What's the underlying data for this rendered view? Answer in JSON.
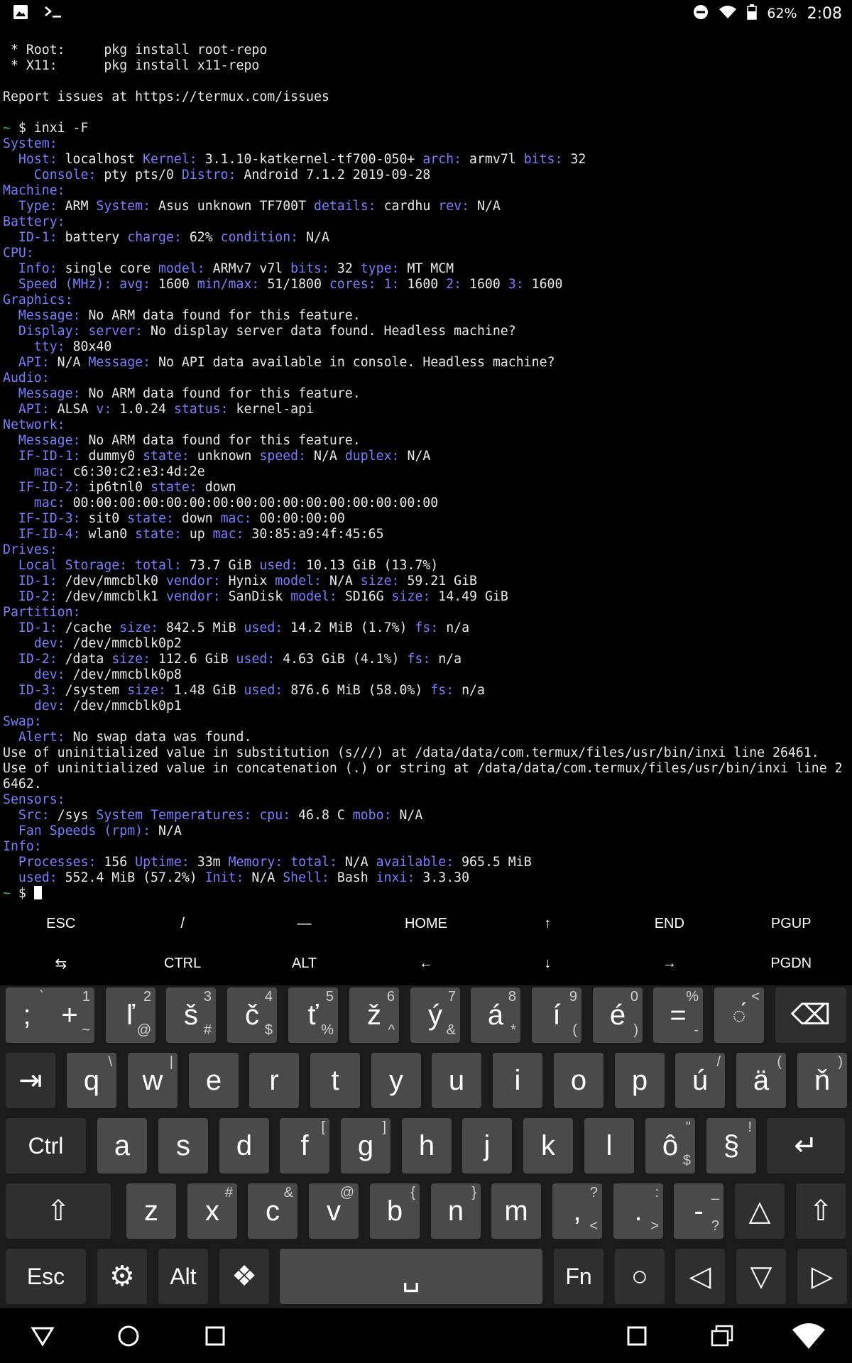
{
  "status_bar": {
    "battery_pct": "62%",
    "time": "2:08",
    "icons": [
      "image-icon",
      "terminal-icon",
      "dnd-icon",
      "wifi-icon",
      "battery-icon"
    ]
  },
  "terminal": {
    "lines": [
      [
        [
          "",
          " * Root:     pkg install root-repo"
        ]
      ],
      [
        [
          "",
          " * X11:      pkg install x11-repo"
        ]
      ],
      [
        [
          "",
          ""
        ]
      ],
      [
        [
          "",
          "Report issues at https://termux.com/issues"
        ]
      ],
      [
        [
          "",
          ""
        ]
      ],
      [
        [
          "g",
          "~ "
        ],
        [
          "",
          "$ inxi -F"
        ]
      ],
      [
        [
          "k",
          "System:"
        ]
      ],
      [
        [
          "k",
          "  Host: "
        ],
        [
          "",
          "localhost "
        ],
        [
          "k",
          "Kernel: "
        ],
        [
          "",
          "3.1.10-katkernel-tf700-050+ "
        ],
        [
          "k",
          "arch: "
        ],
        [
          "",
          "armv7l "
        ],
        [
          "k",
          "bits: "
        ],
        [
          "",
          "32"
        ]
      ],
      [
        [
          "k",
          "    Console: "
        ],
        [
          "",
          "pty pts/0 "
        ],
        [
          "k",
          "Distro: "
        ],
        [
          "",
          "Android 7.1.2 2019-09-28"
        ]
      ],
      [
        [
          "k",
          "Machine:"
        ]
      ],
      [
        [
          "k",
          "  Type: "
        ],
        [
          "",
          "ARM "
        ],
        [
          "k",
          "System: "
        ],
        [
          "",
          "Asus unknown TF700T "
        ],
        [
          "k",
          "details: "
        ],
        [
          "",
          "cardhu "
        ],
        [
          "k",
          "rev: "
        ],
        [
          "",
          "N/A"
        ]
      ],
      [
        [
          "k",
          "Battery:"
        ]
      ],
      [
        [
          "k",
          "  ID-1: "
        ],
        [
          "",
          "battery "
        ],
        [
          "k",
          "charge: "
        ],
        [
          "",
          "62% "
        ],
        [
          "k",
          "condition: "
        ],
        [
          "",
          "N/A"
        ]
      ],
      [
        [
          "k",
          "CPU:"
        ]
      ],
      [
        [
          "k",
          "  Info: "
        ],
        [
          "",
          "single core "
        ],
        [
          "k",
          "model: "
        ],
        [
          "",
          "ARMv7 v7l "
        ],
        [
          "k",
          "bits: "
        ],
        [
          "",
          "32 "
        ],
        [
          "k",
          "type: "
        ],
        [
          "",
          "MT MCM"
        ]
      ],
      [
        [
          "k",
          "  Speed (MHz): avg: "
        ],
        [
          "",
          "1600 "
        ],
        [
          "k",
          "min/max: "
        ],
        [
          "",
          "51/1800 "
        ],
        [
          "k",
          "cores: 1: "
        ],
        [
          "",
          "1600 "
        ],
        [
          "k",
          "2: "
        ],
        [
          "",
          "1600 "
        ],
        [
          "k",
          "3: "
        ],
        [
          "",
          "1600"
        ]
      ],
      [
        [
          "k",
          "Graphics:"
        ]
      ],
      [
        [
          "k",
          "  Message: "
        ],
        [
          "",
          "No ARM data found for this feature."
        ]
      ],
      [
        [
          "k",
          "  Display: server: "
        ],
        [
          "",
          "No display server data found. Headless machine?"
        ]
      ],
      [
        [
          "k",
          "    tty: "
        ],
        [
          "",
          "80x40"
        ]
      ],
      [
        [
          "k",
          "  API: "
        ],
        [
          "",
          "N/A "
        ],
        [
          "k",
          "Message: "
        ],
        [
          "",
          "No API data available in console. Headless machine?"
        ]
      ],
      [
        [
          "k",
          "Audio:"
        ]
      ],
      [
        [
          "k",
          "  Message: "
        ],
        [
          "",
          "No ARM data found for this feature."
        ]
      ],
      [
        [
          "k",
          "  API: "
        ],
        [
          "",
          "ALSA "
        ],
        [
          "k",
          "v: "
        ],
        [
          "",
          "1.0.24 "
        ],
        [
          "k",
          "status: "
        ],
        [
          "",
          "kernel-api"
        ]
      ],
      [
        [
          "k",
          "Network:"
        ]
      ],
      [
        [
          "k",
          "  Message: "
        ],
        [
          "",
          "No ARM data found for this feature."
        ]
      ],
      [
        [
          "k",
          "  IF-ID-1: "
        ],
        [
          "",
          "dummy0 "
        ],
        [
          "k",
          "state: "
        ],
        [
          "",
          "unknown "
        ],
        [
          "k",
          "speed: "
        ],
        [
          "",
          "N/A "
        ],
        [
          "k",
          "duplex: "
        ],
        [
          "",
          "N/A"
        ]
      ],
      [
        [
          "k",
          "    mac: "
        ],
        [
          "",
          "c6:30:c2:e3:4d:2e"
        ]
      ],
      [
        [
          "k",
          "  IF-ID-2: "
        ],
        [
          "",
          "ip6tnl0 "
        ],
        [
          "k",
          "state: "
        ],
        [
          "",
          "down"
        ]
      ],
      [
        [
          "k",
          "    mac: "
        ],
        [
          "",
          "00:00:00:00:00:00:00:00:00:00:00:00:00:00:00:00"
        ]
      ],
      [
        [
          "k",
          "  IF-ID-3: "
        ],
        [
          "",
          "sit0 "
        ],
        [
          "k",
          "state: "
        ],
        [
          "",
          "down "
        ],
        [
          "k",
          "mac: "
        ],
        [
          "",
          "00:00:00:00"
        ]
      ],
      [
        [
          "k",
          "  IF-ID-4: "
        ],
        [
          "",
          "wlan0 "
        ],
        [
          "k",
          "state: "
        ],
        [
          "",
          "up "
        ],
        [
          "k",
          "mac: "
        ],
        [
          "",
          "30:85:a9:4f:45:65"
        ]
      ],
      [
        [
          "k",
          "Drives:"
        ]
      ],
      [
        [
          "k",
          "  Local Storage: total: "
        ],
        [
          "",
          "73.7 GiB "
        ],
        [
          "k",
          "used: "
        ],
        [
          "",
          "10.13 GiB (13.7%)"
        ]
      ],
      [
        [
          "k",
          "  ID-1: "
        ],
        [
          "",
          "/dev/mmcblk0 "
        ],
        [
          "k",
          "vendor: "
        ],
        [
          "",
          "Hynix "
        ],
        [
          "k",
          "model: "
        ],
        [
          "",
          "N/A "
        ],
        [
          "k",
          "size: "
        ],
        [
          "",
          "59.21 GiB"
        ]
      ],
      [
        [
          "k",
          "  ID-2: "
        ],
        [
          "",
          "/dev/mmcblk1 "
        ],
        [
          "k",
          "vendor: "
        ],
        [
          "",
          "SanDisk "
        ],
        [
          "k",
          "model: "
        ],
        [
          "",
          "SD16G "
        ],
        [
          "k",
          "size: "
        ],
        [
          "",
          "14.49 GiB"
        ]
      ],
      [
        [
          "k",
          "Partition:"
        ]
      ],
      [
        [
          "k",
          "  ID-1: "
        ],
        [
          "",
          "/cache "
        ],
        [
          "k",
          "size: "
        ],
        [
          "",
          "842.5 MiB "
        ],
        [
          "k",
          "used: "
        ],
        [
          "",
          "14.2 MiB (1.7%) "
        ],
        [
          "k",
          "fs: "
        ],
        [
          "",
          "n/a"
        ]
      ],
      [
        [
          "k",
          "    dev: "
        ],
        [
          "",
          "/dev/mmcblk0p2"
        ]
      ],
      [
        [
          "k",
          "  ID-2: "
        ],
        [
          "",
          "/data "
        ],
        [
          "k",
          "size: "
        ],
        [
          "",
          "112.6 GiB "
        ],
        [
          "k",
          "used: "
        ],
        [
          "",
          "4.63 GiB (4.1%) "
        ],
        [
          "k",
          "fs: "
        ],
        [
          "",
          "n/a"
        ]
      ],
      [
        [
          "k",
          "    dev: "
        ],
        [
          "",
          "/dev/mmcblk0p8"
        ]
      ],
      [
        [
          "k",
          "  ID-3: "
        ],
        [
          "",
          "/system "
        ],
        [
          "k",
          "size: "
        ],
        [
          "",
          "1.48 GiB "
        ],
        [
          "k",
          "used: "
        ],
        [
          "",
          "876.6 MiB (58.0%) "
        ],
        [
          "k",
          "fs: "
        ],
        [
          "",
          "n/a"
        ]
      ],
      [
        [
          "k",
          "    dev: "
        ],
        [
          "",
          "/dev/mmcblk0p1"
        ]
      ],
      [
        [
          "k",
          "Swap:"
        ]
      ],
      [
        [
          "k",
          "  Alert: "
        ],
        [
          "",
          "No swap data was found."
        ]
      ],
      [
        [
          "",
          "Use of uninitialized value in substitution (s///) at /data/data/com.termux/files/usr/bin/inxi line 26461."
        ]
      ],
      [
        [
          "",
          "Use of uninitialized value in concatenation (.) or string at /data/data/com.termux/files/usr/bin/inxi line 2"
        ]
      ],
      [
        [
          "",
          "6462."
        ]
      ],
      [
        [
          "k",
          "Sensors:"
        ]
      ],
      [
        [
          "k",
          "  Src: "
        ],
        [
          "",
          "/sys "
        ],
        [
          "k",
          "System Temperatures: cpu: "
        ],
        [
          "",
          "46.8 C "
        ],
        [
          "k",
          "mobo: "
        ],
        [
          "",
          "N/A"
        ]
      ],
      [
        [
          "k",
          "  Fan Speeds (rpm): "
        ],
        [
          "",
          "N/A"
        ]
      ],
      [
        [
          "k",
          "Info:"
        ]
      ],
      [
        [
          "k",
          "  Processes: "
        ],
        [
          "",
          "156 "
        ],
        [
          "k",
          "Uptime: "
        ],
        [
          "",
          "33m "
        ],
        [
          "k",
          "Memory: total: "
        ],
        [
          "",
          "N/A "
        ],
        [
          "k",
          "available: "
        ],
        [
          "",
          "965.5 MiB"
        ]
      ],
      [
        [
          "k",
          "  used: "
        ],
        [
          "",
          "552.4 MiB (57.2%) "
        ],
        [
          "k",
          "Init: "
        ],
        [
          "",
          "N/A "
        ],
        [
          "k",
          "Shell: "
        ],
        [
          "",
          "Bash "
        ],
        [
          "k",
          "inxi: "
        ],
        [
          "",
          "3.3.30"
        ]
      ],
      [
        [
          "g",
          "~ "
        ],
        [
          "",
          "$ "
        ]
      ]
    ]
  },
  "extra_keys": {
    "row1": [
      "ESC",
      "/",
      "—",
      "HOME",
      "↑",
      "END",
      "PGUP"
    ],
    "row2": [
      "⇆",
      "CTRL",
      "ALT",
      "←",
      "↓",
      "→",
      "PGDN"
    ]
  },
  "keyboard": {
    "row1": [
      {
        "label": ";",
        "sub": "`"
      },
      {
        "label": "+",
        "sub": "1",
        "sub2": "~"
      },
      {
        "label": "ľ",
        "sub": "2",
        "sub2": "@"
      },
      {
        "label": "š",
        "sub": "3",
        "sub2": "#"
      },
      {
        "label": "č",
        "sub": "4",
        "sub2": "$"
      },
      {
        "label": "ť",
        "sub": "5",
        "sub2": "%"
      },
      {
        "label": "ž",
        "sub": "6",
        "sub2": "^"
      },
      {
        "label": "ý",
        "sub": "7",
        "sub2": "&"
      },
      {
        "label": "á",
        "sub": "8",
        "sub2": "*"
      },
      {
        "label": "í",
        "sub": "9",
        "sub2": "("
      },
      {
        "label": "é",
        "sub": "0",
        "sub2": ")"
      },
      {
        "label": "=",
        "sub": "%",
        "sub2": "-"
      },
      {
        "label": "◌́",
        "sub": "<"
      },
      {
        "label": "⌫"
      }
    ],
    "row2": [
      {
        "label": "⇥"
      },
      {
        "label": "q",
        "sub": "\\"
      },
      {
        "label": "w",
        "sub": "|"
      },
      {
        "label": "e"
      },
      {
        "label": "r"
      },
      {
        "label": "t"
      },
      {
        "label": "y"
      },
      {
        "label": "u"
      },
      {
        "label": "i"
      },
      {
        "label": "o"
      },
      {
        "label": "p"
      },
      {
        "label": "ú",
        "sub": "/"
      },
      {
        "label": "ä",
        "sub": "("
      },
      {
        "label": "ň",
        "sub": ")"
      }
    ],
    "row3": [
      {
        "label": "Ctrl"
      },
      {
        "label": "a"
      },
      {
        "label": "s"
      },
      {
        "label": "d"
      },
      {
        "label": "f",
        "sub": "["
      },
      {
        "label": "g",
        "sub": "]"
      },
      {
        "label": "h"
      },
      {
        "label": "j"
      },
      {
        "label": "k"
      },
      {
        "label": "l"
      },
      {
        "label": "ô",
        "sub": "\"",
        "sub2": "$"
      },
      {
        "label": "§",
        "sub": "!"
      },
      {
        "label": "↵"
      }
    ],
    "row4": [
      {
        "label": "⇧"
      },
      {
        "label": "z"
      },
      {
        "label": "x",
        "sub": "#"
      },
      {
        "label": "c",
        "sub": "&"
      },
      {
        "label": "v",
        "sub": "@"
      },
      {
        "label": "b",
        "sub": "{"
      },
      {
        "label": "n",
        "sub": "}"
      },
      {
        "label": "m"
      },
      {
        "label": ",",
        "sub": "?",
        "sub2": "<"
      },
      {
        "label": ".",
        "sub": ":",
        "sub2": ">"
      },
      {
        "label": "-",
        "sub": "_",
        "sub2": "?"
      },
      {
        "label": "△"
      },
      {
        "label": "⇧"
      }
    ],
    "row5": [
      {
        "label": "Esc"
      },
      {
        "label": "⚙"
      },
      {
        "label": "Alt"
      },
      {
        "label": "❖"
      },
      {
        "label": "␣"
      },
      {
        "label": "Fn"
      },
      {
        "label": "○"
      },
      {
        "label": "◁"
      },
      {
        "label": "▽"
      },
      {
        "label": "▷"
      }
    ]
  },
  "nav_bar": {
    "icons": [
      "back-icon",
      "home-icon",
      "recents-icon",
      "stop-icon",
      "windows-icon",
      "wifi-icon"
    ]
  }
}
